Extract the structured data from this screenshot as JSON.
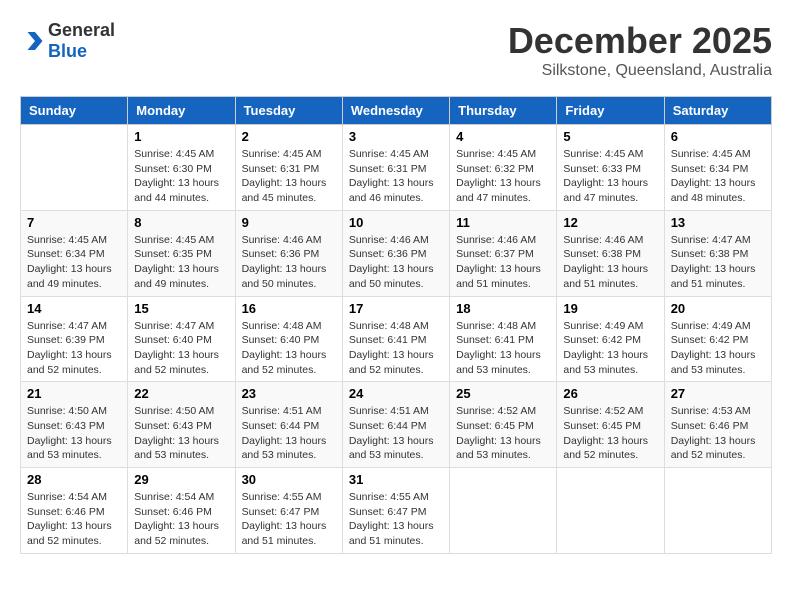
{
  "header": {
    "logo_general": "General",
    "logo_blue": "Blue",
    "month_title": "December 2025",
    "location": "Silkstone, Queensland, Australia"
  },
  "calendar": {
    "days_of_week": [
      "Sunday",
      "Monday",
      "Tuesday",
      "Wednesday",
      "Thursday",
      "Friday",
      "Saturday"
    ],
    "weeks": [
      [
        {
          "day": "",
          "sunrise": "",
          "sunset": "",
          "daylight": ""
        },
        {
          "day": "1",
          "sunrise": "Sunrise: 4:45 AM",
          "sunset": "Sunset: 6:30 PM",
          "daylight": "Daylight: 13 hours and 44 minutes."
        },
        {
          "day": "2",
          "sunrise": "Sunrise: 4:45 AM",
          "sunset": "Sunset: 6:31 PM",
          "daylight": "Daylight: 13 hours and 45 minutes."
        },
        {
          "day": "3",
          "sunrise": "Sunrise: 4:45 AM",
          "sunset": "Sunset: 6:31 PM",
          "daylight": "Daylight: 13 hours and 46 minutes."
        },
        {
          "day": "4",
          "sunrise": "Sunrise: 4:45 AM",
          "sunset": "Sunset: 6:32 PM",
          "daylight": "Daylight: 13 hours and 47 minutes."
        },
        {
          "day": "5",
          "sunrise": "Sunrise: 4:45 AM",
          "sunset": "Sunset: 6:33 PM",
          "daylight": "Daylight: 13 hours and 47 minutes."
        },
        {
          "day": "6",
          "sunrise": "Sunrise: 4:45 AM",
          "sunset": "Sunset: 6:34 PM",
          "daylight": "Daylight: 13 hours and 48 minutes."
        }
      ],
      [
        {
          "day": "7",
          "sunrise": "Sunrise: 4:45 AM",
          "sunset": "Sunset: 6:34 PM",
          "daylight": "Daylight: 13 hours and 49 minutes."
        },
        {
          "day": "8",
          "sunrise": "Sunrise: 4:45 AM",
          "sunset": "Sunset: 6:35 PM",
          "daylight": "Daylight: 13 hours and 49 minutes."
        },
        {
          "day": "9",
          "sunrise": "Sunrise: 4:46 AM",
          "sunset": "Sunset: 6:36 PM",
          "daylight": "Daylight: 13 hours and 50 minutes."
        },
        {
          "day": "10",
          "sunrise": "Sunrise: 4:46 AM",
          "sunset": "Sunset: 6:36 PM",
          "daylight": "Daylight: 13 hours and 50 minutes."
        },
        {
          "day": "11",
          "sunrise": "Sunrise: 4:46 AM",
          "sunset": "Sunset: 6:37 PM",
          "daylight": "Daylight: 13 hours and 51 minutes."
        },
        {
          "day": "12",
          "sunrise": "Sunrise: 4:46 AM",
          "sunset": "Sunset: 6:38 PM",
          "daylight": "Daylight: 13 hours and 51 minutes."
        },
        {
          "day": "13",
          "sunrise": "Sunrise: 4:47 AM",
          "sunset": "Sunset: 6:38 PM",
          "daylight": "Daylight: 13 hours and 51 minutes."
        }
      ],
      [
        {
          "day": "14",
          "sunrise": "Sunrise: 4:47 AM",
          "sunset": "Sunset: 6:39 PM",
          "daylight": "Daylight: 13 hours and 52 minutes."
        },
        {
          "day": "15",
          "sunrise": "Sunrise: 4:47 AM",
          "sunset": "Sunset: 6:40 PM",
          "daylight": "Daylight: 13 hours and 52 minutes."
        },
        {
          "day": "16",
          "sunrise": "Sunrise: 4:48 AM",
          "sunset": "Sunset: 6:40 PM",
          "daylight": "Daylight: 13 hours and 52 minutes."
        },
        {
          "day": "17",
          "sunrise": "Sunrise: 4:48 AM",
          "sunset": "Sunset: 6:41 PM",
          "daylight": "Daylight: 13 hours and 52 minutes."
        },
        {
          "day": "18",
          "sunrise": "Sunrise: 4:48 AM",
          "sunset": "Sunset: 6:41 PM",
          "daylight": "Daylight: 13 hours and 53 minutes."
        },
        {
          "day": "19",
          "sunrise": "Sunrise: 4:49 AM",
          "sunset": "Sunset: 6:42 PM",
          "daylight": "Daylight: 13 hours and 53 minutes."
        },
        {
          "day": "20",
          "sunrise": "Sunrise: 4:49 AM",
          "sunset": "Sunset: 6:42 PM",
          "daylight": "Daylight: 13 hours and 53 minutes."
        }
      ],
      [
        {
          "day": "21",
          "sunrise": "Sunrise: 4:50 AM",
          "sunset": "Sunset: 6:43 PM",
          "daylight": "Daylight: 13 hours and 53 minutes."
        },
        {
          "day": "22",
          "sunrise": "Sunrise: 4:50 AM",
          "sunset": "Sunset: 6:43 PM",
          "daylight": "Daylight: 13 hours and 53 minutes."
        },
        {
          "day": "23",
          "sunrise": "Sunrise: 4:51 AM",
          "sunset": "Sunset: 6:44 PM",
          "daylight": "Daylight: 13 hours and 53 minutes."
        },
        {
          "day": "24",
          "sunrise": "Sunrise: 4:51 AM",
          "sunset": "Sunset: 6:44 PM",
          "daylight": "Daylight: 13 hours and 53 minutes."
        },
        {
          "day": "25",
          "sunrise": "Sunrise: 4:52 AM",
          "sunset": "Sunset: 6:45 PM",
          "daylight": "Daylight: 13 hours and 53 minutes."
        },
        {
          "day": "26",
          "sunrise": "Sunrise: 4:52 AM",
          "sunset": "Sunset: 6:45 PM",
          "daylight": "Daylight: 13 hours and 52 minutes."
        },
        {
          "day": "27",
          "sunrise": "Sunrise: 4:53 AM",
          "sunset": "Sunset: 6:46 PM",
          "daylight": "Daylight: 13 hours and 52 minutes."
        }
      ],
      [
        {
          "day": "28",
          "sunrise": "Sunrise: 4:54 AM",
          "sunset": "Sunset: 6:46 PM",
          "daylight": "Daylight: 13 hours and 52 minutes."
        },
        {
          "day": "29",
          "sunrise": "Sunrise: 4:54 AM",
          "sunset": "Sunset: 6:46 PM",
          "daylight": "Daylight: 13 hours and 52 minutes."
        },
        {
          "day": "30",
          "sunrise": "Sunrise: 4:55 AM",
          "sunset": "Sunset: 6:47 PM",
          "daylight": "Daylight: 13 hours and 51 minutes."
        },
        {
          "day": "31",
          "sunrise": "Sunrise: 4:55 AM",
          "sunset": "Sunset: 6:47 PM",
          "daylight": "Daylight: 13 hours and 51 minutes."
        },
        {
          "day": "",
          "sunrise": "",
          "sunset": "",
          "daylight": ""
        },
        {
          "day": "",
          "sunrise": "",
          "sunset": "",
          "daylight": ""
        },
        {
          "day": "",
          "sunrise": "",
          "sunset": "",
          "daylight": ""
        }
      ]
    ]
  }
}
